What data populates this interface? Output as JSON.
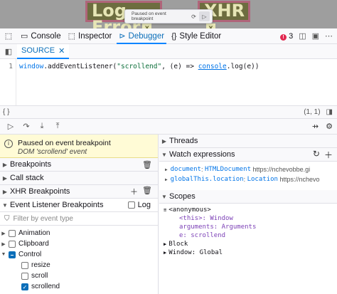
{
  "page": {
    "log_button": "Log Error",
    "xhr_button": "XHR",
    "close_glyph": "x",
    "overlay_text": "Paused on event breakpoint"
  },
  "toolbar": {
    "tabs": [
      {
        "label": "Console",
        "icon": "console-icon"
      },
      {
        "label": "Inspector",
        "icon": "inspector-icon"
      },
      {
        "label": "Debugger",
        "icon": "debugger-icon"
      },
      {
        "label": "Style Editor",
        "icon": "style-editor-icon"
      }
    ],
    "active_tab": "Debugger",
    "error_count": "3",
    "accent_color": "#0a84ff",
    "error_color": "#e22850"
  },
  "source": {
    "tab_label": "SOURCE",
    "line_number": "1",
    "code": {
      "t1": "window",
      "t2": ".addEventListener(",
      "t3": "\"scrollend\"",
      "t4": ", (e) => ",
      "t5": "console",
      "t6": ".log(e))"
    },
    "footer_left": "{ }",
    "cursor_pos": "(1, 1)"
  },
  "paused": {
    "title": "Paused on event breakpoint",
    "detail": "DOM 'scrollend' event",
    "banner_color": "#fffbd6"
  },
  "left": {
    "breakpoints": "Breakpoints",
    "call_stack": "Call stack",
    "xhr": "XHR Breakpoints",
    "event_listener": "Event Listener Breakpoints",
    "log_label": "Log",
    "filter_placeholder": "Filter by event type",
    "events": [
      {
        "label": "Animation",
        "state": "off",
        "expanded": false
      },
      {
        "label": "Clipboard",
        "state": "off",
        "expanded": false
      },
      {
        "label": "Control",
        "state": "mixed",
        "expanded": true
      }
    ],
    "control_children": [
      {
        "label": "resize",
        "state": "off"
      },
      {
        "label": "scroll",
        "state": "off"
      },
      {
        "label": "scrollend",
        "state": "on"
      }
    ]
  },
  "right": {
    "threads": "Threads",
    "watch": "Watch expressions",
    "watch_items": [
      {
        "key": "document",
        "value": "HTMLDocument",
        "url": "https://nchevobbe.gi"
      },
      {
        "key": "globalThis.location",
        "value": "Location",
        "url": "https://nchevo"
      }
    ],
    "scopes": "Scopes",
    "scope_anonymous": "<anonymous>",
    "scope_this": "<this>: Window",
    "scope_arguments": "arguments: Arguments",
    "scope_e": "e: scrollend",
    "scope_block": "Block",
    "scope_window": "Window: Global"
  }
}
